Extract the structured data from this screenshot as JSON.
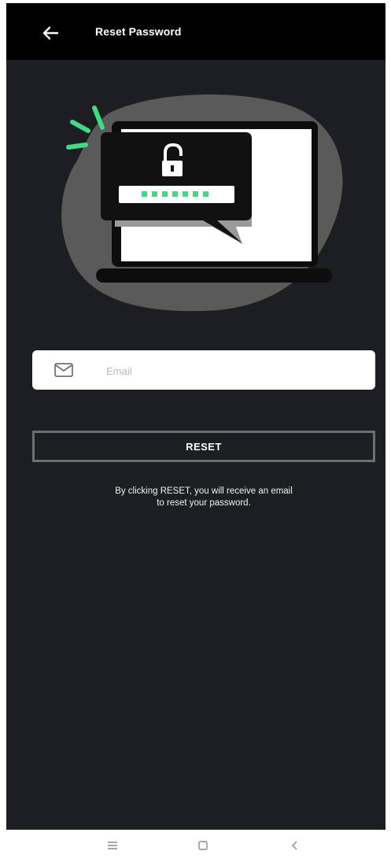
{
  "app_bar": {
    "title": "Reset Password",
    "back_icon": "arrow-left-icon"
  },
  "illustration": {
    "name": "laptop-password-reset-illustration",
    "accent_color": "#3ddc84"
  },
  "form": {
    "email": {
      "placeholder": "Email",
      "value": "",
      "icon": "envelope-icon"
    },
    "reset_button_label": "RESET",
    "helper_line1": "By clicking RESET, you will receive an email",
    "helper_line2": "to reset your password."
  },
  "system_nav": {
    "items": [
      "menu-icon",
      "home-square-icon",
      "back-chevron-icon"
    ]
  },
  "colors": {
    "background": "#1c1e21",
    "app_bar": "#000000",
    "text": "#ffffff"
  }
}
